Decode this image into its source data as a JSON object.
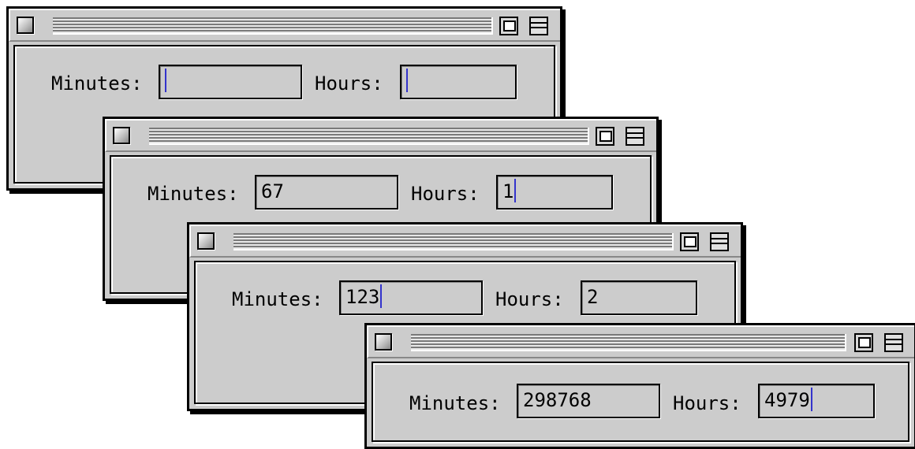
{
  "windows": [
    {
      "minutes_label": "Minutes:",
      "hours_label": "Hours:",
      "minutes_value": "",
      "hours_value": "",
      "active_field": "minutes"
    },
    {
      "minutes_label": "Minutes:",
      "hours_label": "Hours:",
      "minutes_value": "67",
      "hours_value": "1",
      "active_field": "hours"
    },
    {
      "minutes_label": "Minutes:",
      "hours_label": "Hours:",
      "minutes_value": "123",
      "hours_value": "2",
      "active_field": "minutes"
    },
    {
      "minutes_label": "Minutes:",
      "hours_label": "Hours:",
      "minutes_value": "298768",
      "hours_value": "4979",
      "active_field": "hours"
    }
  ],
  "colors": {
    "window_bg": "#cccccc",
    "caret": "#3333cc"
  },
  "icons": [
    "close-box-icon",
    "zoom-box-icon",
    "collapse-box-icon"
  ]
}
